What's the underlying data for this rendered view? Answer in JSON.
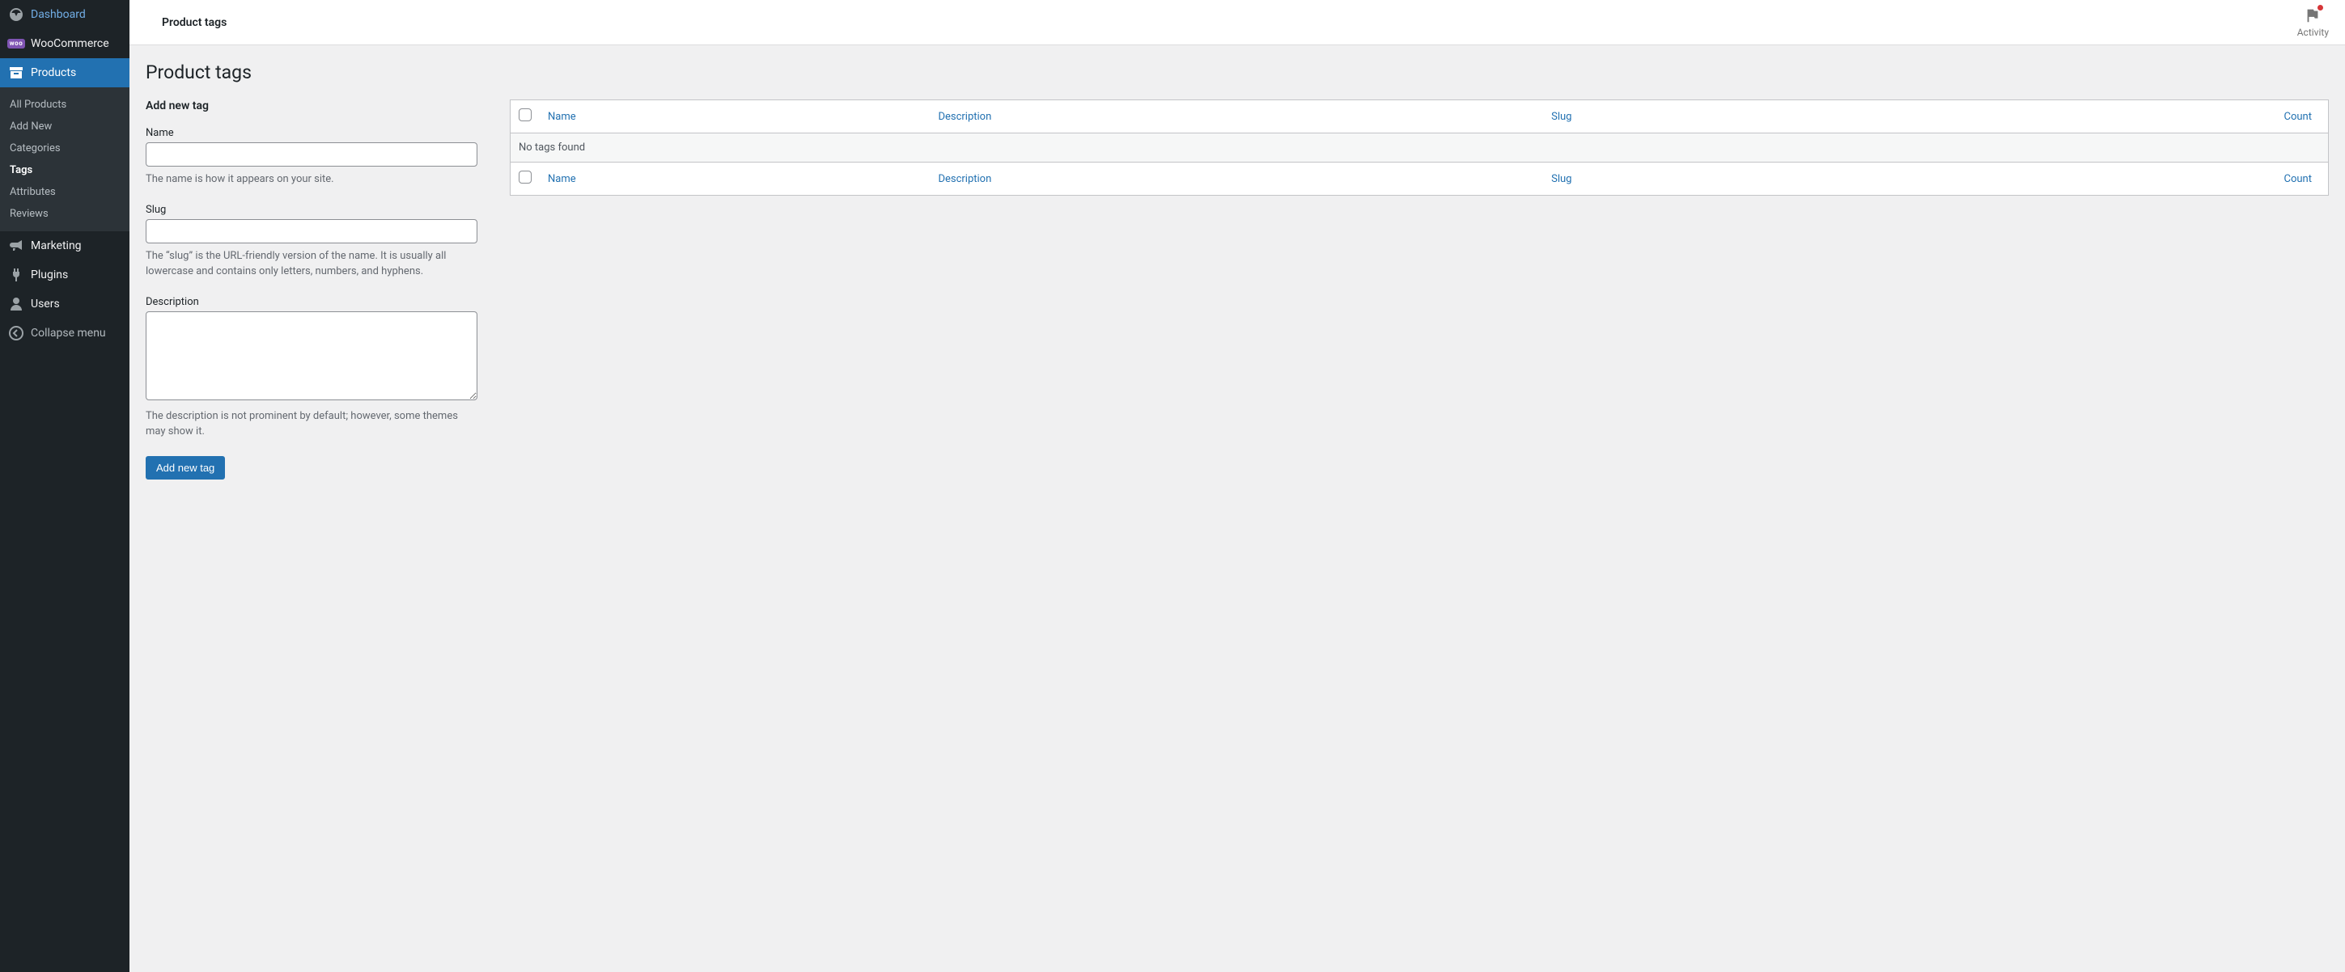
{
  "sidebar": {
    "items": {
      "dashboard": "Dashboard",
      "woocommerce": "WooCommerce",
      "products": "Products",
      "marketing": "Marketing",
      "plugins": "Plugins",
      "users": "Users",
      "collapse": "Collapse menu"
    },
    "products_sub": {
      "all": "All Products",
      "add_new": "Add New",
      "categories": "Categories",
      "tags": "Tags",
      "attributes": "Attributes",
      "reviews": "Reviews"
    }
  },
  "topbar": {
    "title": "Product tags",
    "activity_label": "Activity"
  },
  "page": {
    "heading": "Product tags",
    "form": {
      "section_title": "Add new tag",
      "name_label": "Name",
      "name_help": "The name is how it appears on your site.",
      "slug_label": "Slug",
      "slug_help": "The “slug” is the URL-friendly version of the name. It is usually all lowercase and contains only letters, numbers, and hyphens.",
      "description_label": "Description",
      "description_help": "The description is not prominent by default; however, some themes may show it.",
      "submit_label": "Add new tag"
    },
    "table": {
      "col_name": "Name",
      "col_description": "Description",
      "col_slug": "Slug",
      "col_count": "Count",
      "empty": "No tags found"
    }
  },
  "icons": {
    "woo_badge": "woo"
  }
}
